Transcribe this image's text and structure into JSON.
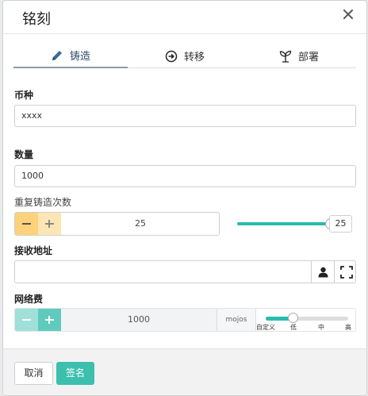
{
  "modal": {
    "title": "铭刻"
  },
  "tabs": [
    {
      "label": "铸造",
      "icon": "pencil-icon",
      "active": true
    },
    {
      "label": "转移",
      "icon": "arrow-circle-icon",
      "active": false
    },
    {
      "label": "部署",
      "icon": "sprout-icon",
      "active": false
    }
  ],
  "form": {
    "currency_label": "币种",
    "currency_value": "xxxx",
    "amount_label": "数量",
    "amount_value": "1000",
    "repeat_label": "重复铸造次数",
    "repeat_value": "25",
    "repeat_slider_value": "25",
    "repeat_slider_fraction": 1.0,
    "address_label": "接收地址",
    "address_value": "",
    "fee_label": "网络费",
    "fee_value": "1000",
    "fee_unit": "mojos",
    "fee_levels": [
      "自定义",
      "低",
      "中",
      "高"
    ],
    "fee_selected_level": "低"
  },
  "footer": {
    "cancel_label": "取消",
    "sign_label": "签名"
  },
  "colors": {
    "accent": "#3dbfae",
    "stepper_minus": "#fcd27a",
    "stepper_plus": "#fde6b4",
    "tab_active": "#2c4a6b"
  }
}
